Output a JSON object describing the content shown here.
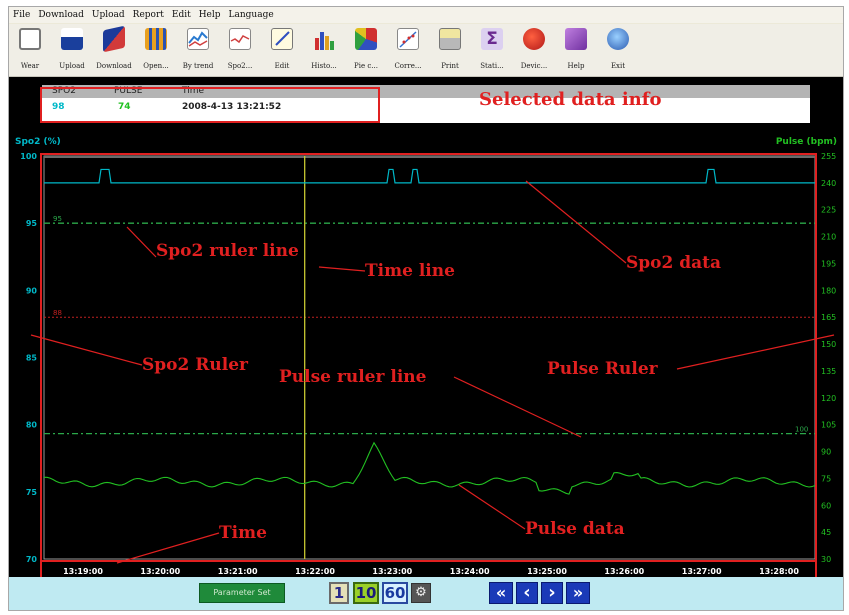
{
  "menu": [
    "File",
    "Download",
    "Upload",
    "Report",
    "Edit",
    "Help",
    "Language"
  ],
  "toolbar": [
    {
      "label": "Wear",
      "icon": "clipboard-icon"
    },
    {
      "label": "Upload",
      "icon": "person-upload-icon"
    },
    {
      "label": "Download",
      "icon": "book-download-icon"
    },
    {
      "label": "Open...",
      "icon": "people-open-icon"
    },
    {
      "label": "By trend",
      "icon": "trend-chart-icon"
    },
    {
      "label": "Spo2...",
      "icon": "spo2-chart-icon"
    },
    {
      "label": "Edit",
      "icon": "edit-note-icon"
    },
    {
      "label": "Histo...",
      "icon": "histogram-icon"
    },
    {
      "label": "Pie c...",
      "icon": "pie-chart-icon"
    },
    {
      "label": "Corre...",
      "icon": "correlation-icon"
    },
    {
      "label": "Print",
      "icon": "printer-icon"
    },
    {
      "label": "Stati...",
      "icon": "sigma-statistics-icon"
    },
    {
      "label": "Devic...",
      "icon": "device-info-icon"
    },
    {
      "label": "Help",
      "icon": "help-book-icon"
    },
    {
      "label": "Exit",
      "icon": "exit-icon"
    }
  ],
  "info": {
    "headers": [
      "SPO2",
      "PULSE",
      "Time"
    ],
    "values": {
      "spo2": "98",
      "pulse": "74",
      "time": "2008-4-13 13:21:52"
    },
    "callout": "Selected data info"
  },
  "axes": {
    "left_title": "Spo2 (%)",
    "right_title": "Pulse (bpm)",
    "spo2_ticks": [
      "100",
      "95",
      "90",
      "85",
      "80",
      "75",
      "70"
    ],
    "pulse_ticks": [
      "255",
      "240",
      "225",
      "210",
      "195",
      "180",
      "165",
      "150",
      "135",
      "120",
      "105",
      "90",
      "75",
      "60",
      "45",
      "30"
    ],
    "time_ticks": [
      "13:19:00",
      "13:20:00",
      "13:21:00",
      "13:22:00",
      "13:23:00",
      "13:24:00",
      "13:25:00",
      "13:26:00",
      "13:27:00",
      "13:28:00"
    ]
  },
  "rulers": {
    "spo2_ruler_label": "95",
    "spo2_alarm_label": "88",
    "pulse_ruler_label": "100"
  },
  "callouts": {
    "spo2_ruler_line": "Spo2 ruler line",
    "time_line": "Time line",
    "spo2_data": "Spo2 data",
    "spo2_ruler": "Spo2 Ruler",
    "pulse_ruler_line": "Pulse ruler line",
    "pulse_ruler": "Pulse Ruler",
    "time": "Time",
    "pulse_data": "Pulse data"
  },
  "bottom": {
    "parameter_button": "Parameter Set",
    "zoom": [
      "1",
      "10",
      "60"
    ],
    "nav": [
      "«",
      "‹",
      "›",
      "»"
    ]
  },
  "colors": {
    "spo2": "#00b8c8",
    "pulse": "#22c022",
    "time_line": "#c8c832",
    "ruler": "#2ba84a",
    "alarm": "#c02020",
    "callout": "#e02020"
  }
}
